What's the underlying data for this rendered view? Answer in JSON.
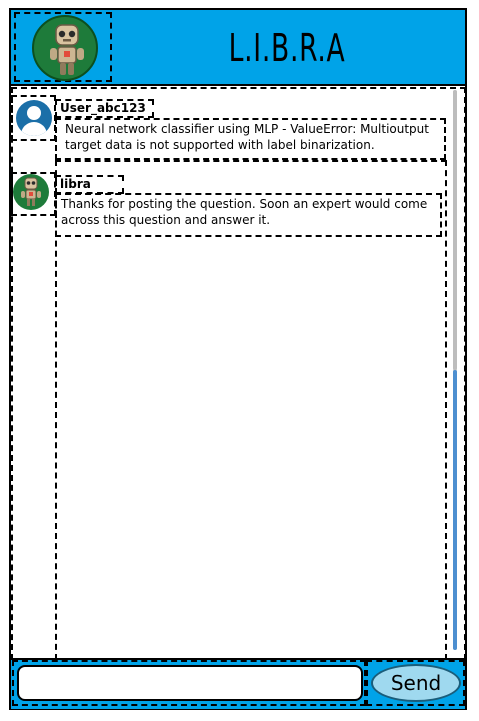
{
  "header": {
    "title": "L.I.B.R.A",
    "logo_icon": "robot-icon"
  },
  "messages": [
    {
      "sender": "User_abc123",
      "avatar_icon": "user-icon",
      "text": "Neural network classifier using MLP - ValueError: Multioutput target data is not supported with label binarization."
    },
    {
      "sender": "libra",
      "avatar_icon": "robot-icon",
      "text": "Thanks for posting the question. Soon an expert would come across this question and answer it."
    }
  ],
  "composer": {
    "input_value": "",
    "send_label": "Send"
  },
  "colors": {
    "header_bg": "#00a3e8",
    "send_bg": "#9fd9ef"
  }
}
